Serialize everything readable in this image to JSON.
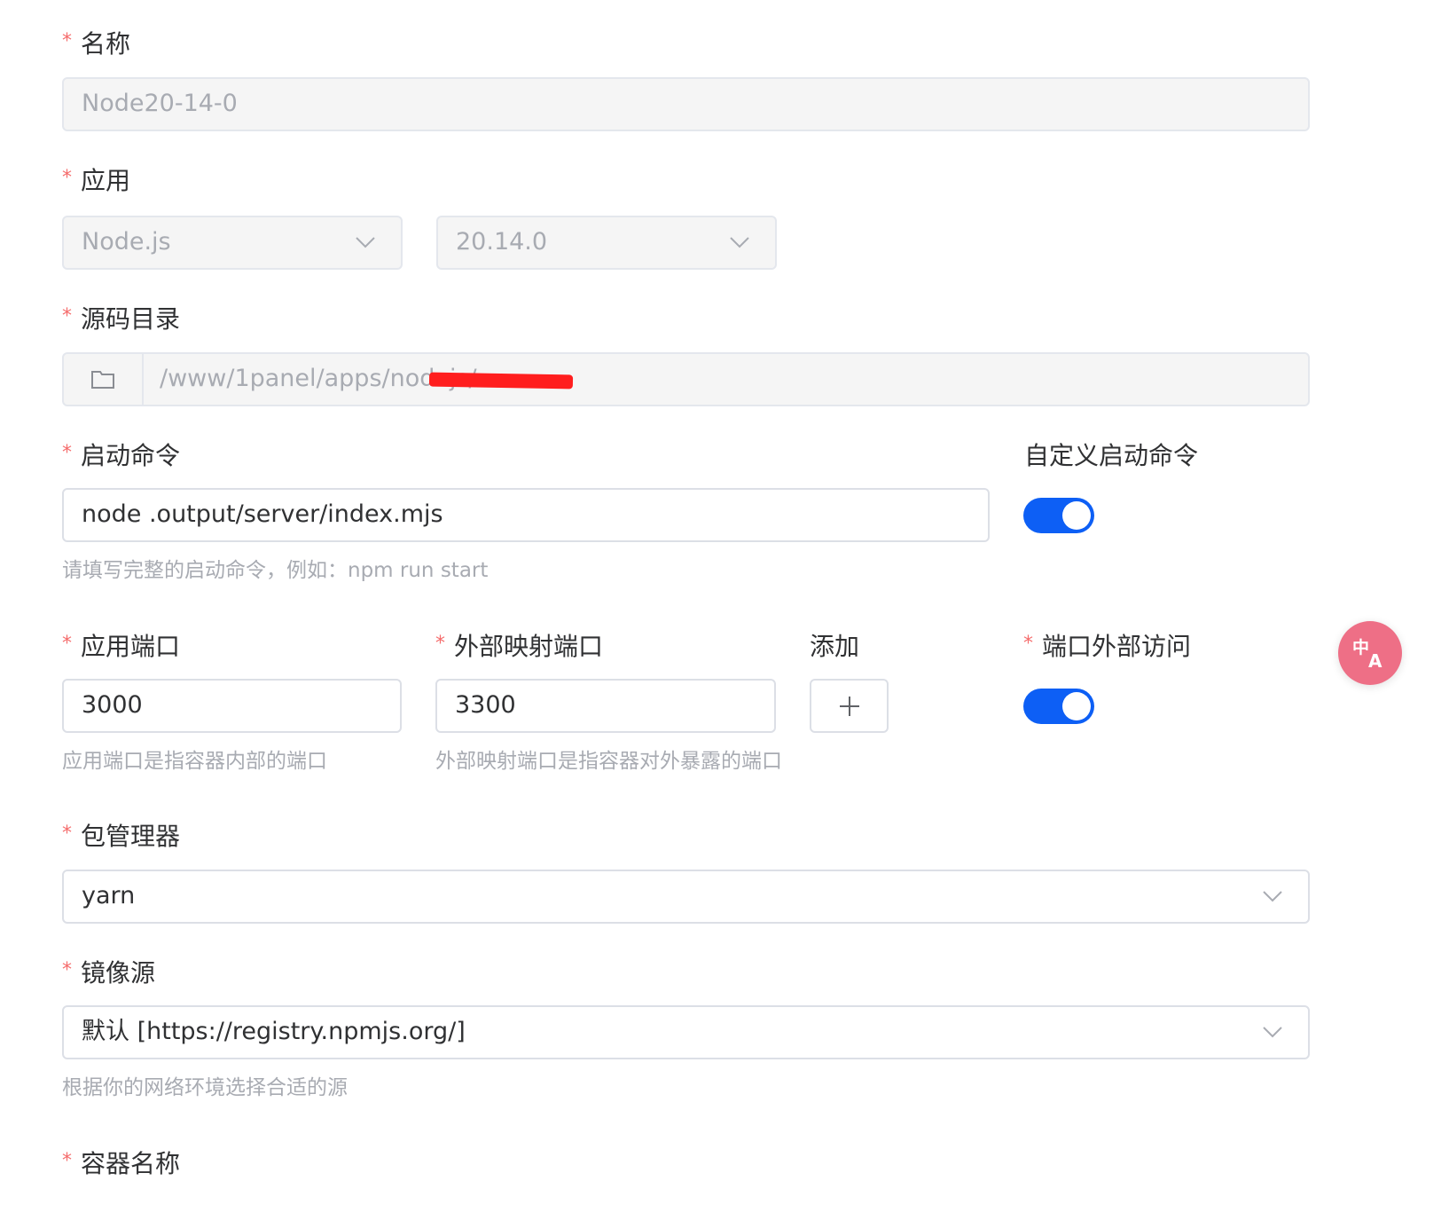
{
  "form": {
    "name": {
      "label": "名称",
      "value": "Node20-14-0"
    },
    "app": {
      "label": "应用",
      "runtime": "Node.js",
      "version": "20.14.0"
    },
    "source_dir": {
      "label": "源码目录",
      "value": "/www/1panel/apps/nodejs/"
    },
    "start_cmd": {
      "label": "启动命令",
      "value": "node .output/server/index.mjs",
      "help": "请填写完整的启动命令，例如：npm run start",
      "custom_label": "自定义启动命令",
      "custom_enabled": true
    },
    "ports": {
      "app_port_label": "应用端口",
      "app_port_value": "3000",
      "app_port_help": "应用端口是指容器内部的端口",
      "ext_port_label": "外部映射端口",
      "ext_port_value": "3300",
      "ext_port_help": "外部映射端口是指容器对外暴露的端口",
      "add_label": "添加",
      "external_access_label": "端口外部访问",
      "external_access_enabled": true
    },
    "package_manager": {
      "label": "包管理器",
      "value": "yarn"
    },
    "mirror": {
      "label": "镜像源",
      "value": "默认 [https://registry.npmjs.org/]",
      "help": "根据你的网络环境选择合适的源"
    },
    "container_name": {
      "label": "容器名称"
    }
  },
  "required_mark": "*",
  "colors": {
    "accent": "#0d5ff5",
    "required": "#f56c6c",
    "translate": "#ee6f86"
  },
  "icons": {
    "chevron": "chevron-down-icon",
    "folder": "folder-icon",
    "plus": "plus-icon",
    "translate": "translate-icon"
  }
}
